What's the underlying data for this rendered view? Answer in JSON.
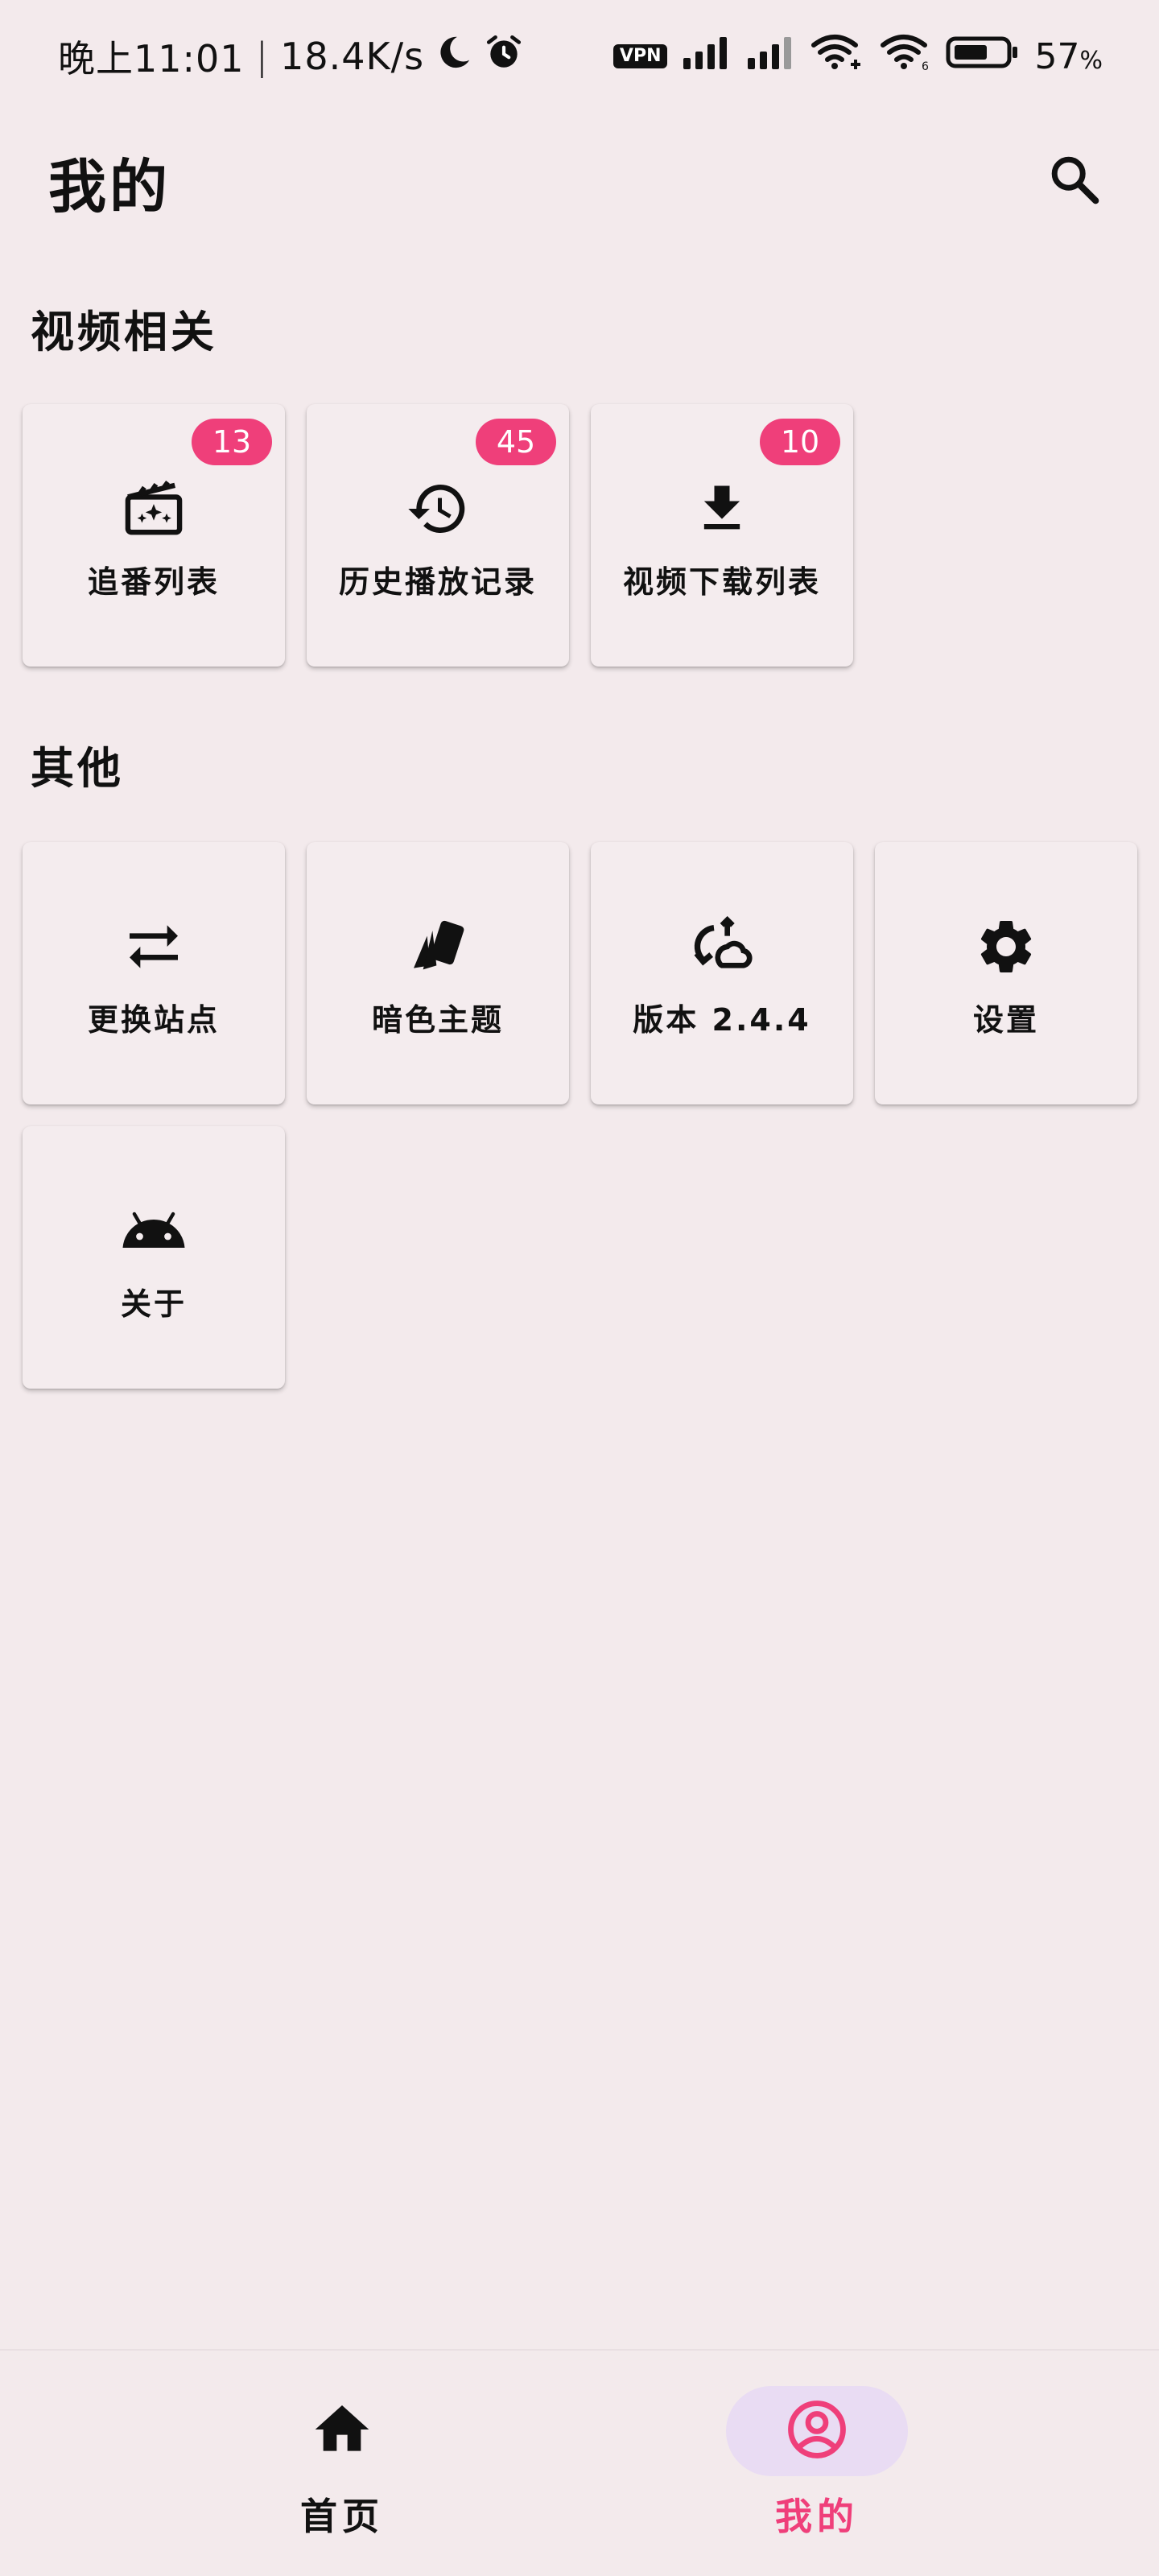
{
  "status_bar": {
    "time": "晚上11:01",
    "separator": "|",
    "speed": "18.4K/s",
    "vpn": "VPN",
    "battery": "57",
    "battery_unit": "%"
  },
  "header": {
    "title": "我的"
  },
  "sections": {
    "video": {
      "title": "视频相关",
      "tiles": [
        {
          "label": "追番列表",
          "badge": "13",
          "icon": "movie-sparkle-icon"
        },
        {
          "label": "历史播放记录",
          "badge": "45",
          "icon": "history-icon"
        },
        {
          "label": "视频下载列表",
          "badge": "10",
          "icon": "download-icon"
        }
      ]
    },
    "other": {
      "title": "其他",
      "tiles": [
        {
          "label": "更换站点",
          "icon": "swap-icon"
        },
        {
          "label": "暗色主题",
          "icon": "cards-icon"
        },
        {
          "label": "版本 2.4.4",
          "icon": "version-icon"
        },
        {
          "label": "设置",
          "icon": "gear-icon"
        },
        {
          "label": "关于",
          "icon": "android-icon"
        }
      ]
    }
  },
  "bottom_nav": {
    "items": [
      {
        "label": "首页",
        "icon": "home-icon",
        "active": false
      },
      {
        "label": "我的",
        "icon": "account-circle-icon",
        "active": true
      }
    ]
  },
  "colors": {
    "accent": "#ef3f7a",
    "background": "#f3eaec",
    "nav_active_pill": "#e9dcf3"
  }
}
